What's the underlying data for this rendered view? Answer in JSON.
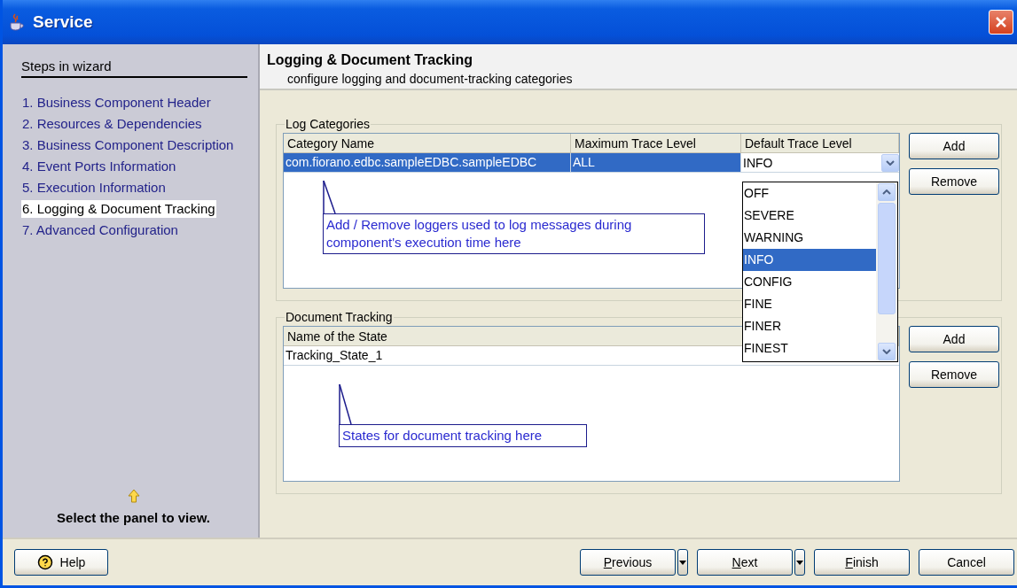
{
  "window": {
    "title": "Service"
  },
  "sidebar": {
    "heading": "Steps in wizard",
    "steps": [
      {
        "label": "1. Business Component Header",
        "selected": false
      },
      {
        "label": "2. Resources & Dependencies",
        "selected": false
      },
      {
        "label": "3. Business Component Description",
        "selected": false
      },
      {
        "label": "4. Event Ports Information",
        "selected": false
      },
      {
        "label": "5. Execution Information",
        "selected": false
      },
      {
        "label": "6. Logging & Document Tracking",
        "selected": true
      },
      {
        "label": "7. Advanced Configuration",
        "selected": false
      }
    ],
    "hint": "Select the panel to view."
  },
  "header": {
    "title": "Logging & Document Tracking",
    "subtitle": "configure logging and document-tracking categories"
  },
  "log_categories": {
    "title": "Log Categories",
    "columns": [
      "Category Name",
      "Maximum Trace Level",
      "Default Trace Level"
    ],
    "rows": [
      {
        "cells": [
          "com.fiorano.edbc.sampleEDBC.sampleEDBC",
          "ALL",
          "INFO"
        ],
        "selected": true
      }
    ],
    "callout": "Add / Remove loggers used to log messages during component's execution time here",
    "dropdown_items": [
      {
        "label": "OFF",
        "selected": false
      },
      {
        "label": "SEVERE",
        "selected": false
      },
      {
        "label": "WARNING",
        "selected": false
      },
      {
        "label": "INFO",
        "selected": true
      },
      {
        "label": "CONFIG",
        "selected": false
      },
      {
        "label": "FINE",
        "selected": false
      },
      {
        "label": "FINER",
        "selected": false
      },
      {
        "label": "FINEST",
        "selected": false
      }
    ],
    "buttons": [
      "Add",
      "Remove"
    ]
  },
  "document_tracking": {
    "title": "Document Tracking",
    "columns": [
      "Name of the State"
    ],
    "rows": [
      {
        "cells": [
          "Tracking_State_1"
        ],
        "selected": false
      }
    ],
    "callout": "States for document tracking here",
    "buttons": [
      "Add",
      "Remove"
    ]
  },
  "footer": {
    "help": "Help",
    "buttons": [
      {
        "label": "Previous",
        "kind": "split",
        "mnemonic": true
      },
      {
        "label": "Next",
        "kind": "split",
        "mnemonic": true
      },
      {
        "label": "Finish",
        "kind": "plain",
        "mnemonic": true
      },
      {
        "label": "Cancel",
        "kind": "plain",
        "mnemonic": false
      }
    ]
  }
}
